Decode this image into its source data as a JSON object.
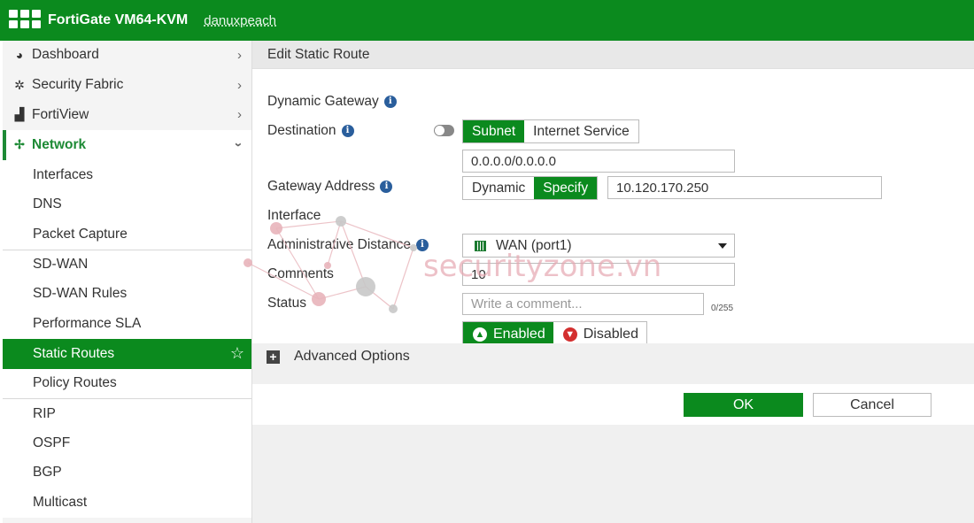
{
  "header": {
    "title": "FortiGate VM64-KVM",
    "hostname": "danuxpeach"
  },
  "sidebar": {
    "top_items": [
      {
        "label": "Dashboard",
        "icon": "dashboard-icon"
      },
      {
        "label": "Security Fabric",
        "icon": "fabric-icon"
      },
      {
        "label": "FortiView",
        "icon": "fortiview-icon"
      }
    ],
    "network_label": "Network",
    "sub_items": [
      {
        "label": "Interfaces"
      },
      {
        "label": "DNS"
      },
      {
        "label": "Packet Capture"
      },
      {
        "label": "SD-WAN"
      },
      {
        "label": "SD-WAN Rules"
      },
      {
        "label": "Performance SLA"
      },
      {
        "label": "Static Routes"
      },
      {
        "label": "Policy Routes"
      },
      {
        "label": "RIP"
      },
      {
        "label": "OSPF"
      },
      {
        "label": "BGP"
      },
      {
        "label": "Multicast"
      }
    ]
  },
  "panel": {
    "title": "Edit Static Route"
  },
  "form": {
    "dynamic_gateway_label": "Dynamic Gateway",
    "destination_label": "Destination",
    "destination_options": [
      "Subnet",
      "Internet Service"
    ],
    "destination_value": "0.0.0.0/0.0.0.0",
    "gateway_label": "Gateway Address",
    "gateway_options": [
      "Dynamic",
      "Specify"
    ],
    "gateway_value": "10.120.170.250",
    "interface_label": "Interface",
    "interface_value": "WAN (port1)",
    "distance_label": "Administrative Distance",
    "distance_value": "10",
    "comments_label": "Comments",
    "comments_placeholder": "Write a comment...",
    "comments_counter": "0/255",
    "status_label": "Status",
    "status_enabled": "Enabled",
    "status_disabled": "Disabled"
  },
  "advanced": {
    "label": "Advanced Options"
  },
  "footer": {
    "ok_label": "OK",
    "cancel_label": "Cancel"
  },
  "watermark": {
    "text": "securityzone.vn"
  },
  "colors": {
    "brand_green": "#0b8a1e",
    "info_blue": "#2a5e9c",
    "disabled_red": "#d32f2f"
  }
}
